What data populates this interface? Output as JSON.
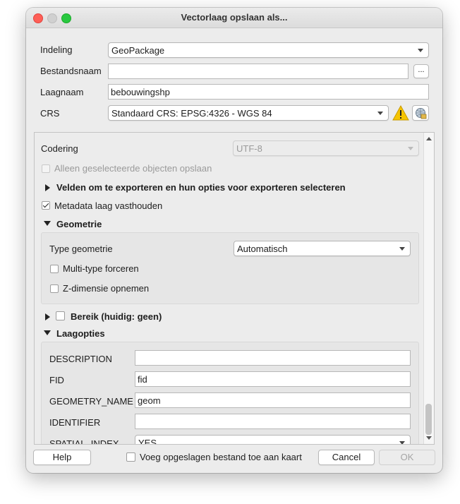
{
  "window": {
    "title": "Vectorlaag opslaan als..."
  },
  "top": {
    "format_label": "Indeling",
    "format_value": "GeoPackage",
    "filename_label": "Bestandsnaam",
    "filename_value": "",
    "browse_label": "...",
    "layername_label": "Laagnaam",
    "layername_value": "bebouwingshp",
    "crs_label": "CRS",
    "crs_value": "Standaard CRS: EPSG:4326 - WGS 84"
  },
  "options": {
    "encoding_label": "Codering",
    "encoding_value": "UTF-8",
    "selected_only_label": "Alleen geselecteerde objecten opslaan",
    "fields_section_label": "Velden om te exporteren en hun opties voor exporteren selecteren",
    "keep_metadata_label": "Metadata laag vasthouden",
    "geometry_section_label": "Geometrie",
    "geometry_type_label": "Type geometrie",
    "geometry_type_value": "Automatisch",
    "force_multi_label": "Multi-type forceren",
    "include_z_label": "Z-dimensie opnemen",
    "extent_section_label": "Bereik (huidig: geen)",
    "layer_options_section_label": "Laagopties",
    "layer_options": [
      {
        "key": "DESCRIPTION",
        "value": ""
      },
      {
        "key": "FID",
        "value": "fid"
      },
      {
        "key": "GEOMETRY_NAME",
        "value": "geom"
      },
      {
        "key": "IDENTIFIER",
        "value": ""
      },
      {
        "key": "SPATIAL_INDEX",
        "value": "YES"
      }
    ]
  },
  "footer": {
    "help_label": "Help",
    "add_to_map_label": "Voeg opgeslagen bestand toe aan kaart",
    "cancel_label": "Cancel",
    "ok_label": "OK"
  },
  "colors": {
    "warning": "#f5c400",
    "close": "#fe5f57",
    "zoom": "#28c840"
  },
  "icons": {
    "warning": "warning-icon",
    "crs_select": "crs-globe-icon"
  }
}
